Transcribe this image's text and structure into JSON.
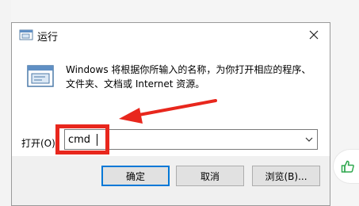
{
  "dialog": {
    "title": "运行",
    "description": "Windows 将根据你所输入的名称，为你打开相应的程序、文件夹、文档或 Internet 资源。",
    "open_label": "打开(O):",
    "input_value": "cmd",
    "buttons": {
      "ok": "确定",
      "cancel": "取消",
      "browse": "浏览(B)..."
    }
  },
  "icons": {
    "title": "run-icon",
    "large": "run-icon",
    "close": "close-icon",
    "dropdown": "chevron-down-icon",
    "side": "thumbs-up-icon"
  },
  "colors": {
    "highlight": "#e8271d",
    "accent": "#0078d7",
    "side_icon": "#2fa84f"
  }
}
